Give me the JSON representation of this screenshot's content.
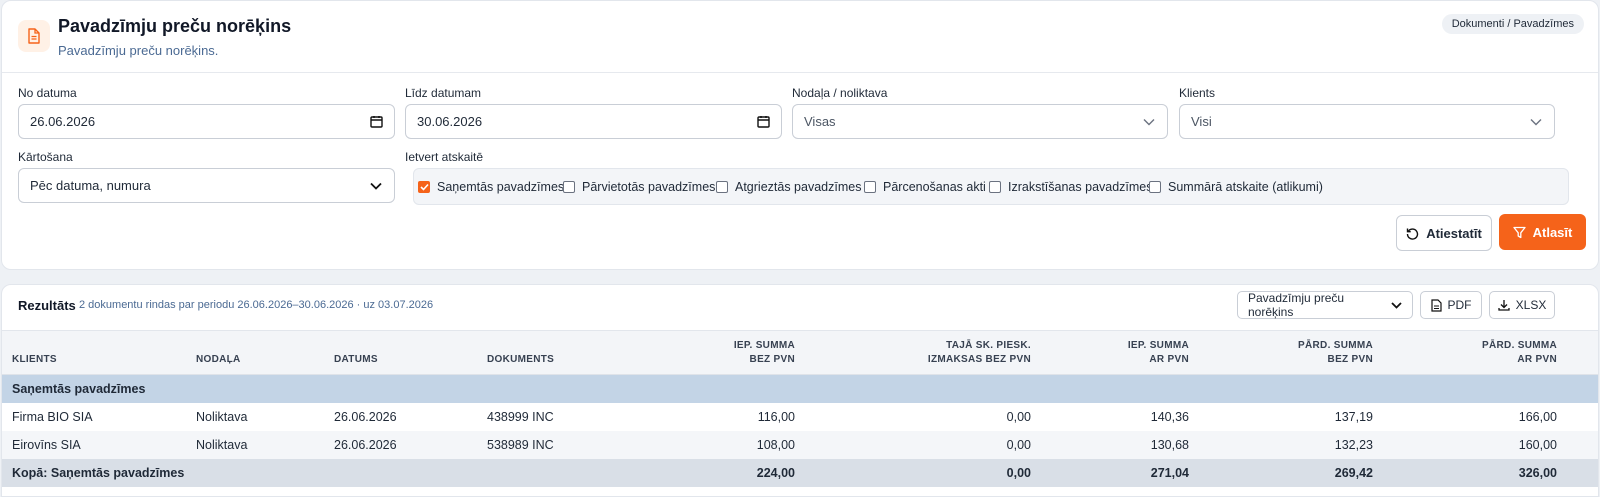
{
  "header": {
    "title": "Pavadzīmju preču norēķins",
    "subtitle": "Pavadzīmju preču norēķins.",
    "breadcrumb": "Dokumenti / Pavadzīmes"
  },
  "filters": {
    "from_label": "No datuma",
    "from_value": "26.06.2026",
    "to_label": "Līdz datumam",
    "to_value": "30.06.2026",
    "dept_label": "Nodaļa / noliktava",
    "dept_value": "Visas",
    "client_label": "Klients",
    "client_value": "Visi",
    "sort_label": "Kārtošana",
    "sort_value": "Pēc datuma, numura",
    "report_label": "Ietvert atskaitē",
    "reports": [
      {
        "label": "Saņemtās pavadzīmes",
        "checked": true
      },
      {
        "label": "Pārvietotās pavadzīmes",
        "checked": false
      },
      {
        "label": "Atgrieztās pavadzīmes",
        "checked": false
      },
      {
        "label": "Pārcenošanas akti",
        "checked": false
      },
      {
        "label": "Izrakstīšanas pavadzīmes",
        "checked": false
      },
      {
        "label": "Summārā atskaite (atlikumi)",
        "checked": false
      }
    ],
    "reset_label": "Atiestatīt",
    "submit_label": "Atlasīt"
  },
  "results": {
    "title": "Rezultāts",
    "meta": "2 dokumentu rindas par periodu 26.06.2026–30.06.2026 · uz 03.07.2026",
    "report_select": "Pavadzīmju preču norēķins",
    "pdf_label": "PDF",
    "xlsx_label": "XLSX",
    "columns": {
      "client": "KLIENTS",
      "dept": "NODAĻA",
      "date": "DATUMS",
      "doc": "DOKUMENTS",
      "c1_line1": "IEP. SUMMA",
      "c1_line2": "BEZ PVN",
      "c2_line1": "TAJĀ SK. PIESK.",
      "c2_line2": "IZMAKSAS BEZ PVN",
      "c3_line1": "IEP. SUMMA",
      "c3_line2": "AR PVN",
      "c4_line1": "PĀRD. SUMMA",
      "c4_line2": "BEZ PVN",
      "c5_line1": "PĀRD. SUMMA",
      "c5_line2": "AR PVN"
    },
    "group_label": "Saņemtās pavadzīmes",
    "rows": [
      {
        "client": "Firma BIO SIA",
        "dept": "Noliktava",
        "date": "26.06.2026",
        "doc": "438999 INC",
        "c1": "116,00",
        "c2": "0,00",
        "c3": "140,36",
        "c4": "137,19",
        "c5": "166,00"
      },
      {
        "client": "Eirovīns SIA",
        "dept": "Noliktava",
        "date": "26.06.2026",
        "doc": "538989 INC",
        "c1": "108,00",
        "c2": "0,00",
        "c3": "130,68",
        "c4": "132,23",
        "c5": "160,00"
      }
    ],
    "total": {
      "label": "Kopā: Saņemtās pavadzīmes",
      "c1": "224,00",
      "c2": "0,00",
      "c3": "271,04",
      "c4": "269,42",
      "c5": "326,00"
    }
  },
  "colors": {
    "accent": "#f5631a",
    "group_row": "#c3d4e6",
    "total_row": "#d9dfe7"
  }
}
